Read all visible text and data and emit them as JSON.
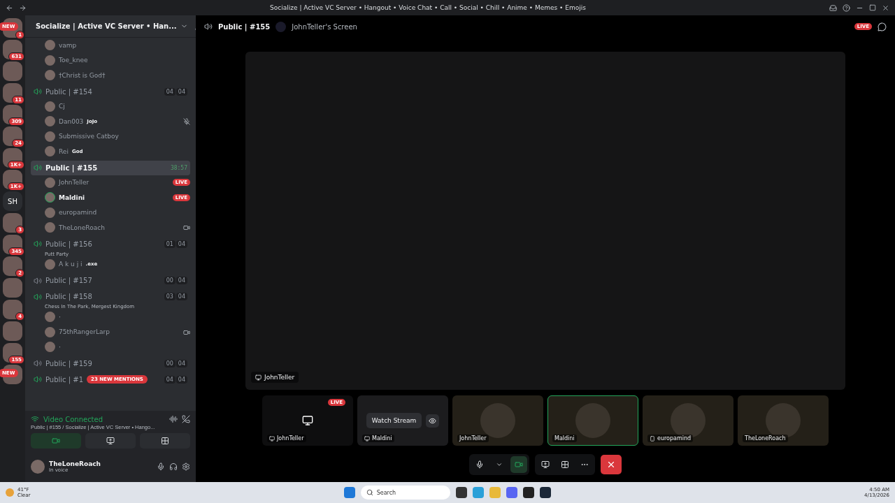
{
  "window": {
    "title": "Socialize | Active VC Server • Hangout • Voice Chat • Call • Social • Chill • Anime • Memes • Emojis"
  },
  "servers": [
    {
      "kind": "pill",
      "label": "NEW",
      "badge": "1"
    },
    {
      "kind": "icon",
      "badge": "631"
    },
    {
      "kind": "icon"
    },
    {
      "kind": "icon",
      "badge": "11"
    },
    {
      "kind": "icon",
      "badge": "309"
    },
    {
      "kind": "icon",
      "badge": "24"
    },
    {
      "kind": "icon",
      "badge": "1K+"
    },
    {
      "kind": "icon",
      "badge": "1K+"
    },
    {
      "kind": "text",
      "label": "SH"
    },
    {
      "kind": "icon",
      "badge": "3"
    },
    {
      "kind": "icon",
      "badge": "345"
    },
    {
      "kind": "icon",
      "badge": "2"
    },
    {
      "kind": "icon"
    },
    {
      "kind": "icon",
      "badge": "4"
    },
    {
      "kind": "icon"
    },
    {
      "kind": "icon",
      "badge": "155"
    },
    {
      "kind": "pill",
      "label": "NEW"
    }
  ],
  "server_header": {
    "name": "Socialize | Active VC Server • Han..."
  },
  "loose_users": [
    {
      "name": "vamp"
    },
    {
      "name": "Toe_knee"
    },
    {
      "name": "†Christ is God†"
    }
  ],
  "channels": [
    {
      "name": "Public | #154",
      "connected": true,
      "selected": false,
      "counts": [
        "04",
        "04"
      ],
      "users": [
        {
          "name": "Cj"
        },
        {
          "name": "Dan003",
          "tag": "JoJo",
          "muted": true
        },
        {
          "name": "Submissive Catboy"
        },
        {
          "name": "Rei",
          "tag": "God"
        }
      ]
    },
    {
      "name": "Public | #155",
      "connected": true,
      "selected": true,
      "timer": "38:57",
      "users": [
        {
          "name": "JohnTeller",
          "live": "LIVE"
        },
        {
          "name": "Maldini",
          "live": "LIVE",
          "speaking": true
        },
        {
          "name": "europamind"
        },
        {
          "name": "TheLoneRoach",
          "video": true
        }
      ]
    },
    {
      "name": "Public | #156",
      "connected": true,
      "selected": false,
      "activity": "Putt Party",
      "counts": [
        "01",
        "04"
      ],
      "users": [
        {
          "name": "A k u j i",
          "tag": ".exe"
        }
      ]
    },
    {
      "name": "Public | #157",
      "connected": false,
      "selected": false,
      "counts": [
        "00",
        "04"
      ]
    },
    {
      "name": "Public | #158",
      "connected": true,
      "selected": false,
      "activity": "Chess In The Park, Mergest Kingdom",
      "counts": [
        "03",
        "04"
      ],
      "users": [
        {
          "name": "·"
        },
        {
          "name": "75thRangerLarp",
          "video": true
        },
        {
          "name": "·"
        }
      ]
    },
    {
      "name": "Public | #159",
      "connected": false,
      "selected": false,
      "counts": [
        "00",
        "04"
      ]
    },
    {
      "name": "Public | #1",
      "connected": true,
      "selected": false,
      "counts": [
        "04",
        "04"
      ],
      "pill": "23 NEW MENTIONS"
    }
  ],
  "voice_panel": {
    "status": "Video Connected",
    "location": "Public | #155 / Socialize | Active VC Server • Hango...",
    "camera_on": true
  },
  "user_panel": {
    "name": "TheLoneRoach",
    "status": "In voice"
  },
  "stage": {
    "channel": "Public | #155",
    "screen": "JohnTeller's Screen",
    "live": "LIVE",
    "stream_label": "JohnTeller"
  },
  "tiles": [
    {
      "kind": "stream",
      "name": "JohnTeller",
      "live": "LIVE",
      "selected": false
    },
    {
      "kind": "watch",
      "name": "Maldini",
      "action": "Watch Stream",
      "selected": false
    },
    {
      "kind": "video",
      "name": "JohnTeller",
      "selected": false
    },
    {
      "kind": "video",
      "name": "Maldini",
      "selected": true
    },
    {
      "kind": "mobile",
      "name": "europamind",
      "selected": false
    },
    {
      "kind": "video",
      "name": "TheLoneRoach",
      "selected": false
    }
  ],
  "taskbar": {
    "temperature": "41°F",
    "weather": "Clear",
    "search": "Search",
    "time": "4:50 AM",
    "date": "4/13/2026"
  }
}
